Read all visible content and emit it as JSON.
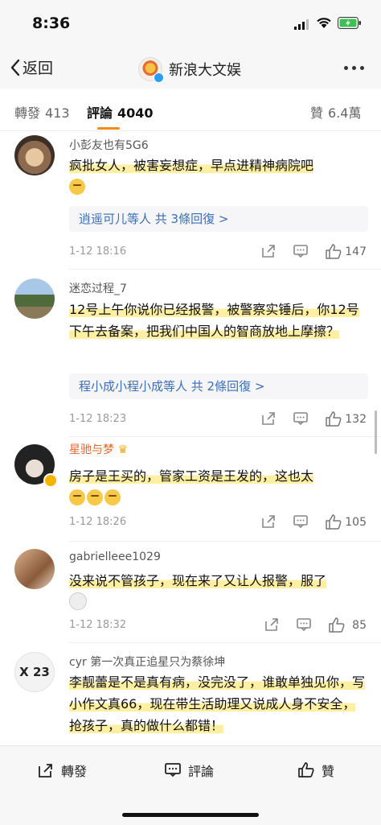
{
  "status": {
    "time": "8:36"
  },
  "nav": {
    "back_label": "返回",
    "title": "新浪大文娱"
  },
  "tabs": [
    {
      "label": "轉發",
      "count": "413"
    },
    {
      "label": "評論",
      "count": "4040"
    },
    {
      "label": "贊",
      "count": "6.4萬"
    }
  ],
  "comments": [
    {
      "user": "小彭友也有5G6",
      "text": "疯批女人，被害妄想症，早点进精神病院吧",
      "replies": "逍遥可儿等人 共 3條回復 >",
      "date": "1-12 18:16",
      "likes": "147"
    },
    {
      "user": "迷恋过程_7",
      "text": "12号上午你说你已经报警，被警察实锤后，你12号下午去备案，把我们中国人的智商放地上摩擦？",
      "replies": "程小成小程小成等人 共 2條回復 >",
      "date": "1-12 18:23",
      "likes": "132"
    },
    {
      "user": "星驰与梦",
      "text": "房子是王买的，管家工资是王发的，这也太",
      "date": "1-12 18:26",
      "likes": "105"
    },
    {
      "user": "gabrielleee1029",
      "text": "没来说不管孩子，现在来了又让人报警，服了",
      "date": "1-12 18:32",
      "likes": "85"
    },
    {
      "user": "cyr 第一次真正追星只为蔡徐坤",
      "text": "李靓蕾是不是真有病，没完没了，谁敢单独见你，写小作文真66，现在带生活助理又说成人身不安全，抢孩子，真的做什么都错！",
      "avatar_text": "X 23"
    }
  ],
  "bottom": {
    "repost": "轉發",
    "comment": "評論",
    "like": "贊"
  },
  "colors": {
    "accent": "#f28b1a",
    "link": "#3b6fb6",
    "highlight": "#ffea82"
  }
}
